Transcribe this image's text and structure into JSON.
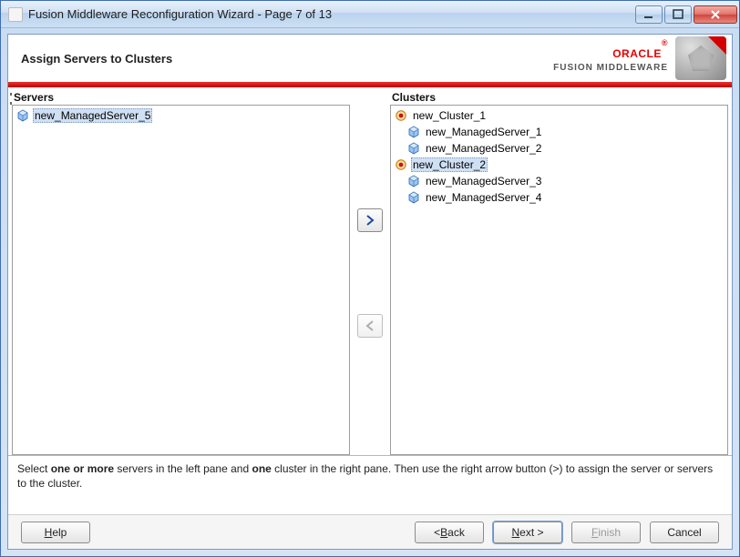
{
  "window": {
    "title": "Fusion Middleware Reconfiguration Wizard - Page 7 of 13"
  },
  "brand": {
    "name": "ORACLE",
    "reg": "®",
    "sub": "FUSION MIDDLEWARE"
  },
  "page": {
    "heading": "Assign Servers to Clusters"
  },
  "servers": {
    "title": "Servers",
    "items": [
      {
        "label": "new_ManagedServer_5",
        "selected": true
      }
    ]
  },
  "clusters": {
    "title": "Clusters",
    "nodes": [
      {
        "label": "new_Cluster_1",
        "selected": false,
        "children": [
          {
            "label": "new_ManagedServer_1"
          },
          {
            "label": "new_ManagedServer_2"
          }
        ]
      },
      {
        "label": "new_Cluster_2",
        "selected": true,
        "children": [
          {
            "label": "new_ManagedServer_3"
          },
          {
            "label": "new_ManagedServer_4"
          }
        ]
      }
    ]
  },
  "hint": {
    "pre": "Select ",
    "b1": "one or more",
    "mid1": " servers in the left pane and ",
    "b2": "one",
    "post": " cluster in the right pane. Then use the right arrow button (>) to assign the server or servers to the cluster."
  },
  "buttons": {
    "help": "elp",
    "help_accel": "H",
    "back": "< ",
    "back_label": "ack",
    "back_accel": "B",
    "next_accel": "N",
    "next_label": "ext >",
    "finish_accel": "F",
    "finish_label": "inish",
    "cancel": "Cancel"
  },
  "transfer": {
    "right_enabled": true,
    "left_enabled": false
  }
}
